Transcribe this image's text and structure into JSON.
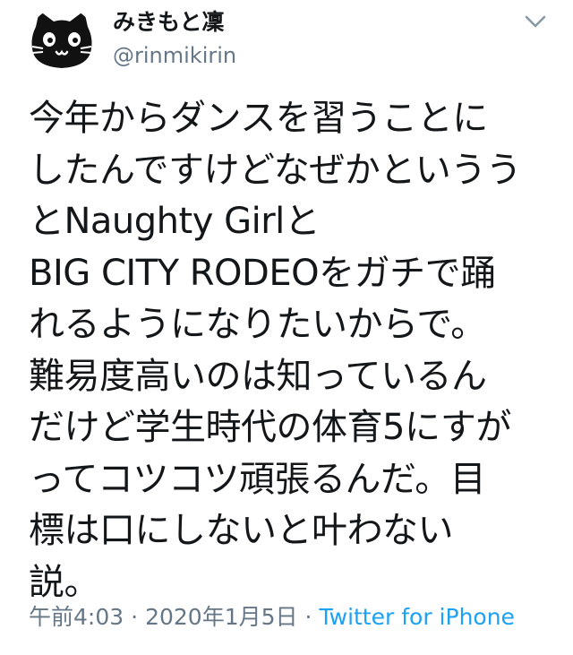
{
  "user": {
    "display_name": "みきもと凜",
    "handle": "@rinmikirin",
    "avatar_icon": "cat-icon"
  },
  "menu_icon": "chevron-down-icon",
  "tweet": {
    "lines": [
      "今年からダンスを習うことに",
      "したんですけどなぜかというう",
      "とNaughty Girlと",
      "BIG CITY RODEOをガチで踊",
      "れるようになりたいからで。",
      "難易度高いのは知っているん",
      "だけど学生時代の体育5にすが",
      "ってコツコツ頑張るんだ。目",
      "標は口にしないと叶わない",
      "説。"
    ]
  },
  "meta": {
    "time": "午前4:03",
    "separator": "·",
    "date": "2020年1月5日",
    "source": "Twitter for iPhone"
  },
  "colors": {
    "text": "#14171a",
    "secondary": "#657786",
    "link": "#1da1f2"
  }
}
